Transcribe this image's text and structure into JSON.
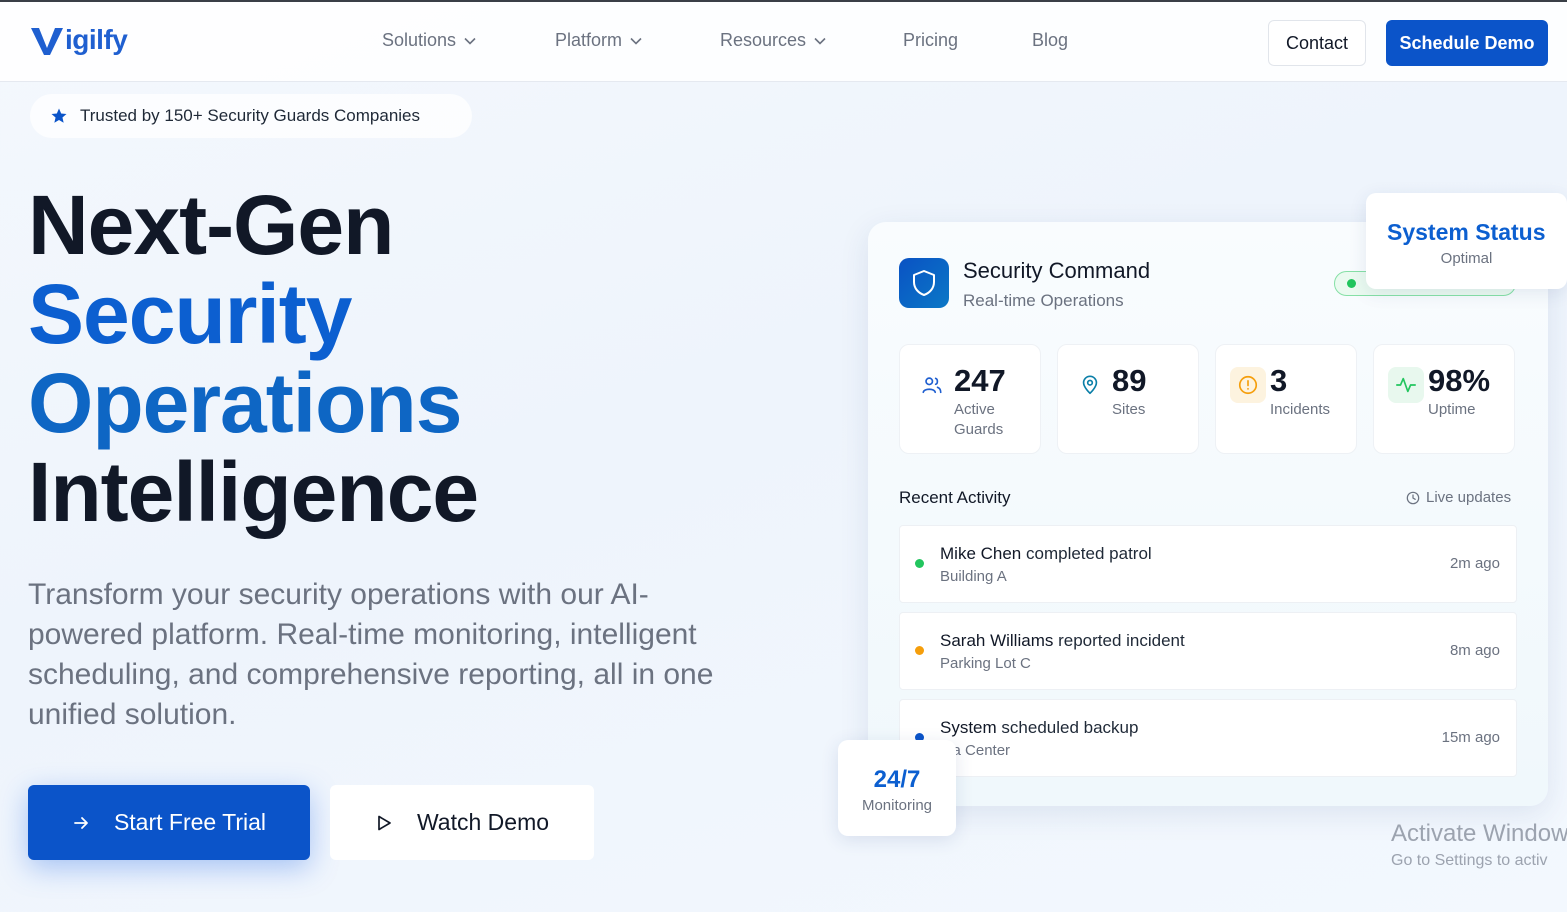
{
  "brand": {
    "name": "igilfy",
    "accent": "#0b54c9"
  },
  "nav": {
    "items": [
      {
        "label": "Solutions",
        "dropdown": true
      },
      {
        "label": "Platform",
        "dropdown": true
      },
      {
        "label": "Resources",
        "dropdown": true
      },
      {
        "label": "Pricing",
        "dropdown": false
      },
      {
        "label": "Blog",
        "dropdown": false
      }
    ],
    "contact_label": "Contact",
    "demo_label": "Schedule Demo"
  },
  "trust_badge": {
    "text": "Trusted by 150+ Security Guards Companies",
    "icon": "star-icon"
  },
  "hero": {
    "line1": "Next-Gen",
    "line2": "Security",
    "line3": "Operations",
    "line4": "Intelligence",
    "lead": "Transform your security operations with our AI-powered platform. Real-time monitoring, intelligent scheduling, and comprehensive reporting, all in one unified solution.",
    "cta_primary": "Start Free Trial",
    "cta_secondary": "Watch Demo"
  },
  "dashboard": {
    "title": "Security Command",
    "subtitle": "Real-time Operations",
    "stats": [
      {
        "value": "247",
        "label": "Active Guards",
        "icon": "users-icon",
        "color": "#1f5fd0"
      },
      {
        "value": "89",
        "label": "Sites",
        "icon": "map-pin-icon",
        "color": "#0b7fa8"
      },
      {
        "value": "3",
        "label": "Incidents",
        "icon": "alert-circle-icon",
        "color": "#f59e0b"
      },
      {
        "value": "98%",
        "label": "Uptime",
        "icon": "activity-icon",
        "color": "#22c55e"
      }
    ],
    "recent_activity_title": "Recent Activity",
    "live_label": "Live updates",
    "activities": [
      {
        "actor": "Mike Chen",
        "action": "completed patrol",
        "location": "Building A",
        "time": "2m ago",
        "color": "#22c55e"
      },
      {
        "actor": "Sarah Williams",
        "action": "reported incident",
        "location": "Parking Lot C",
        "time": "8m ago",
        "color": "#f59e0b"
      },
      {
        "actor": "System",
        "action": "scheduled backup",
        "location": "ata Center",
        "time": "15m ago",
        "color": "#0b54c9"
      }
    ]
  },
  "system_status": {
    "title": "System Status",
    "value": "Optimal"
  },
  "monitoring": {
    "value": "24/7",
    "label": "Monitoring"
  },
  "watermark": {
    "line1": "Activate Window",
    "line2": "Go to Settings to activ"
  }
}
